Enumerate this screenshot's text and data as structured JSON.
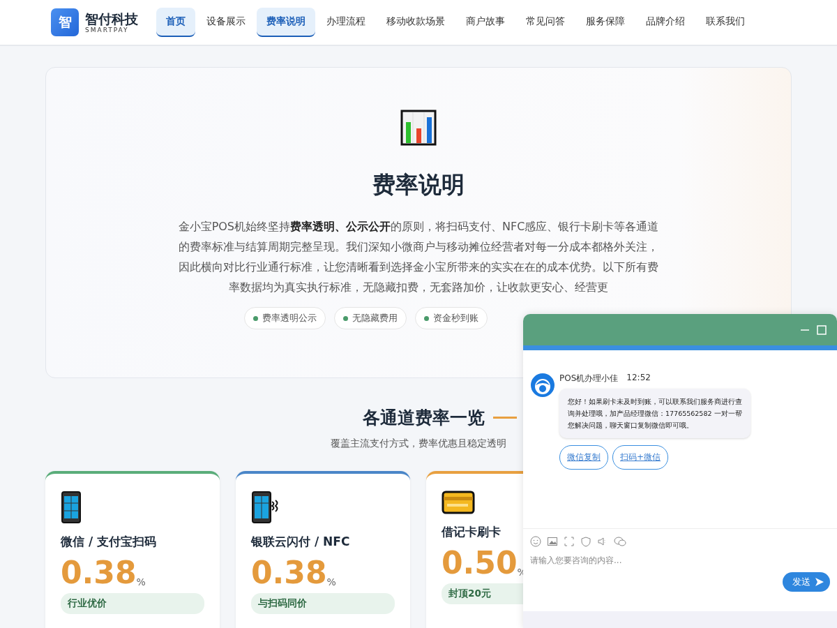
{
  "brand": {
    "logo": "智",
    "name": "智付科技",
    "tagline": "SMARTPAY"
  },
  "nav": [
    {
      "label": "首页",
      "selected": true
    },
    {
      "label": "设备展示",
      "selected": false
    },
    {
      "label": "费率说明",
      "selected": true
    },
    {
      "label": "办理流程",
      "selected": false
    },
    {
      "label": "移动收款场景",
      "selected": false
    },
    {
      "label": "商户故事",
      "selected": false
    },
    {
      "label": "常见问答",
      "selected": false
    },
    {
      "label": "服务保障",
      "selected": false
    },
    {
      "label": "品牌介绍",
      "selected": false
    },
    {
      "label": "联系我们",
      "selected": false
    }
  ],
  "hero": {
    "title": "费率说明",
    "paragraph": "金小宝POS机始终坚持**费率透明、公示公开**的原则，将扫码支付、NFC感应、银行卡刷卡等各通道的费率标准与结算周期完整呈现。我们深知小微商户与移动摊位经营者对每一分成本都格外关注，因此横向对比行业通行标准，让您清晰看到选择金小宝所带来的实实在在的成本优势。以下所有费率数据均为真实执行标准，无隐藏扣费，无套路加价，让收款更安心、经营更",
    "pills": [
      "费率透明公示",
      "无隐藏费用",
      "资金秒到账"
    ]
  },
  "rates": {
    "title": "各通道费率一览",
    "subtitle": "覆盖主流支付方式，费率优惠且稳定透明",
    "cards": [
      {
        "kind": "phone",
        "title": "微信 / 支付宝扫码",
        "rate": "0.38",
        "unit": "%",
        "badge": "行业优价",
        "color": "#5aad7a"
      },
      {
        "kind": "nfc",
        "title": "银联云闪付 / NFC",
        "rate": "0.38",
        "unit": "%",
        "badge": "与扫码同价",
        "color": "#4a86c8"
      },
      {
        "kind": "card",
        "title": "借记卡刷卡",
        "rate": "0.50",
        "unit": "%",
        "badge": "封顶20元",
        "color": "#e8a040"
      }
    ]
  },
  "chat": {
    "sender": "POS机办理小佳",
    "time": "12:52",
    "message": "您好！如果刷卡未及时到账，可以联系我们服务商进行查询并处理哦，加产品经理微信：17765562582 一对一帮您解决问题，聊天窗口复制微信即可哦。",
    "actions": [
      "微信复制",
      "扫码+微信"
    ],
    "input": {
      "placeholder": "请输入您要咨询的内容..."
    },
    "send": "发送"
  }
}
